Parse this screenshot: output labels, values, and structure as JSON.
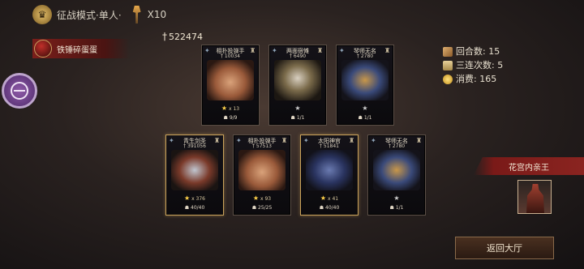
{
  "header": {
    "mode_label": "征战模式·单人·",
    "torch_count": "X10"
  },
  "player": {
    "name": "铁锤碎蛋蛋"
  },
  "total_power": "522474",
  "stats": {
    "rounds": "回合数: 15",
    "triple": "三连次数: 5",
    "cost": "消费: 165"
  },
  "cards": [
    {
      "name": "相扑投弹手",
      "power": "10034",
      "stars": "x 13",
      "hp": "9/9",
      "star_color": "gold",
      "frame": "plain",
      "portrait": "sumo"
    },
    {
      "name": "两面宿傩",
      "power": "6490",
      "stars": "",
      "hp": "1/1",
      "star_color": "grey",
      "frame": "plain",
      "portrait": "demon"
    },
    {
      "name": "琴师无名",
      "power": "2780",
      "stars": "",
      "hp": "1/1",
      "star_color": "grey",
      "frame": "plain",
      "portrait": "musician"
    },
    {
      "name": "青生剑圣",
      "power": "391056",
      "stars": "x 376",
      "hp": "40/40",
      "star_color": "gold",
      "frame": "gold",
      "portrait": "swordsman"
    },
    {
      "name": "相扑投弹手",
      "power": "57513",
      "stars": "x 93",
      "hp": "25/25",
      "star_color": "gold",
      "frame": "plain",
      "portrait": "sumo"
    },
    {
      "name": "太阳神官",
      "power": "51841",
      "stars": "x 41",
      "hp": "40/40",
      "star_color": "gold",
      "frame": "gold",
      "portrait": "priest"
    },
    {
      "name": "琴师无名",
      "power": "2780",
      "stars": "",
      "hp": "1/1",
      "star_color": "grey",
      "frame": "plain",
      "portrait": "musician"
    }
  ],
  "boss": {
    "name": "花宫内亲王"
  },
  "buttons": {
    "return_label": "返回大厅"
  },
  "icons": {
    "mode": "crown-emblem-icon",
    "torch": "torch-icon",
    "dagger": "dagger-icon",
    "star": "star-icon",
    "skull": "skull-icon"
  }
}
